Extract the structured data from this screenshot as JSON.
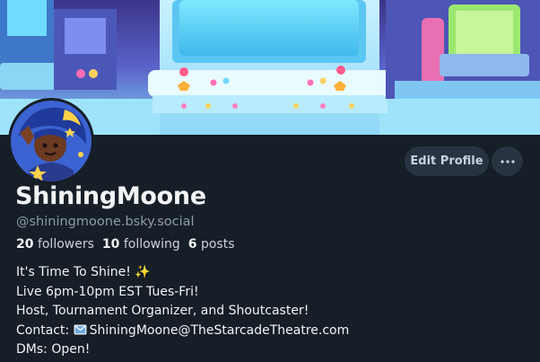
{
  "profile": {
    "display_name": "ShiningMoone",
    "handle": "@shiningmoone.bsky.social",
    "stats": {
      "followers_count": "20",
      "followers_label": "followers",
      "following_count": "10",
      "following_label": "following",
      "posts_count": "6",
      "posts_label": "posts"
    },
    "bio": {
      "line1": "It's Time To Shine! ✨",
      "line2": "Live 6pm-10pm EST Tues-Fri!",
      "line3": "Host, Tournament Organizer, and Shoutcaster!",
      "line4_prefix": "Contact: ",
      "line4_email": "ShiningMoone@TheStarcadeTheatre.com",
      "line5": "DMs: Open!"
    }
  },
  "actions": {
    "edit_profile_label": "Edit Profile",
    "more_icon": "ellipsis-icon"
  },
  "colors": {
    "background": "#161e27",
    "button_bg": "#283342",
    "muted_text": "#8d9bab"
  }
}
